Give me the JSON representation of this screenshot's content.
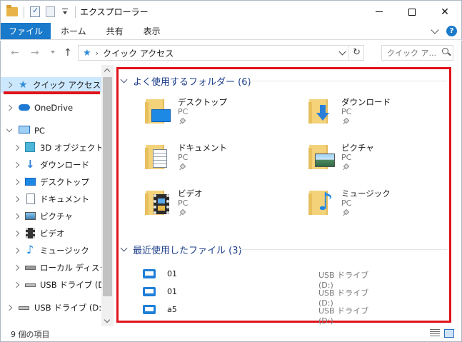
{
  "window": {
    "title": "エクスプローラー",
    "minimize_label": "",
    "close_label": "✕"
  },
  "ribbon": {
    "tabs": [
      {
        "label": "ファイル"
      },
      {
        "label": "ホーム"
      },
      {
        "label": "共有"
      },
      {
        "label": "表示"
      }
    ],
    "help_label": "?"
  },
  "address": {
    "back_label": "←",
    "forward_label": "→",
    "up_label": "↑",
    "path_separator": "›",
    "location": "クイック アクセス",
    "refresh_label": "↻",
    "search_placeholder": "クイック ア..."
  },
  "sidebar": {
    "items": [
      {
        "label": "クイック アクセス",
        "icon": "star-icon",
        "selected": true
      },
      {
        "label": "OneDrive",
        "icon": "cloud-icon"
      },
      {
        "label": "PC",
        "icon": "pc-icon",
        "expanded": true
      },
      {
        "label": "3D オブジェクト",
        "icon": "3d-objects-icon"
      },
      {
        "label": "ダウンロード",
        "icon": "download-icon"
      },
      {
        "label": "デスクトップ",
        "icon": "desktop-icon"
      },
      {
        "label": "ドキュメント",
        "icon": "documents-icon"
      },
      {
        "label": "ピクチャ",
        "icon": "pictures-icon"
      },
      {
        "label": "ビデオ",
        "icon": "videos-icon"
      },
      {
        "label": "ミュージック",
        "icon": "music-icon"
      },
      {
        "label": "ローカル ディスク (C",
        "icon": "local-disk-icon"
      },
      {
        "label": "USB ドライブ (D:)",
        "icon": "usb-drive-icon"
      },
      {
        "label": "USB ドライブ (D:)",
        "icon": "usb-drive-icon"
      }
    ]
  },
  "content": {
    "frequent_header": "よく使用するフォルダー (6)",
    "frequent_folders": [
      {
        "name": "デスクトップ",
        "location": "PC",
        "icon": "desktop-folder-icon"
      },
      {
        "name": "ダウンロード",
        "location": "PC",
        "icon": "download-folder-icon"
      },
      {
        "name": "ドキュメント",
        "location": "PC",
        "icon": "documents-folder-icon"
      },
      {
        "name": "ピクチャ",
        "location": "PC",
        "icon": "pictures-folder-icon"
      },
      {
        "name": "ビデオ",
        "location": "PC",
        "icon": "videos-folder-icon"
      },
      {
        "name": "ミュージック",
        "location": "PC",
        "icon": "music-folder-icon"
      }
    ],
    "recent_header": "最近使用したファイル (3)",
    "recent_files": [
      {
        "name": "01",
        "location": "USB ドライブ (D:)"
      },
      {
        "name": "01",
        "location": "USB ドライブ (D:)"
      },
      {
        "name": "a5",
        "location": "USB ドライブ (D:)"
      }
    ]
  },
  "status": {
    "item_count": "9 個の項目"
  },
  "colors": {
    "accent": "#1979ca",
    "highlight_red": "#e0121a",
    "selection": "#cce8ff",
    "group_header": "#1e3f8a"
  }
}
